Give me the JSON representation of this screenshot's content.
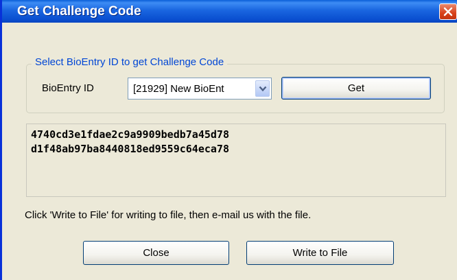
{
  "window": {
    "title": "Get Challenge Code"
  },
  "group": {
    "legend": "Select BioEntry ID to get Challenge Code",
    "field_label": "BioEntry ID",
    "select_value": "[21929] New BioEnt",
    "get_label": "Get"
  },
  "code": {
    "lines": [
      "4740cd3e1fdae2c9a9909bedb7a45d78",
      "d1f48ab97ba8440818ed9559c64eca78"
    ]
  },
  "info": "Click 'Write to File' for writing to file, then e-mail us with the file.",
  "buttons": {
    "close_label": "Close",
    "write_label": "Write to File"
  }
}
